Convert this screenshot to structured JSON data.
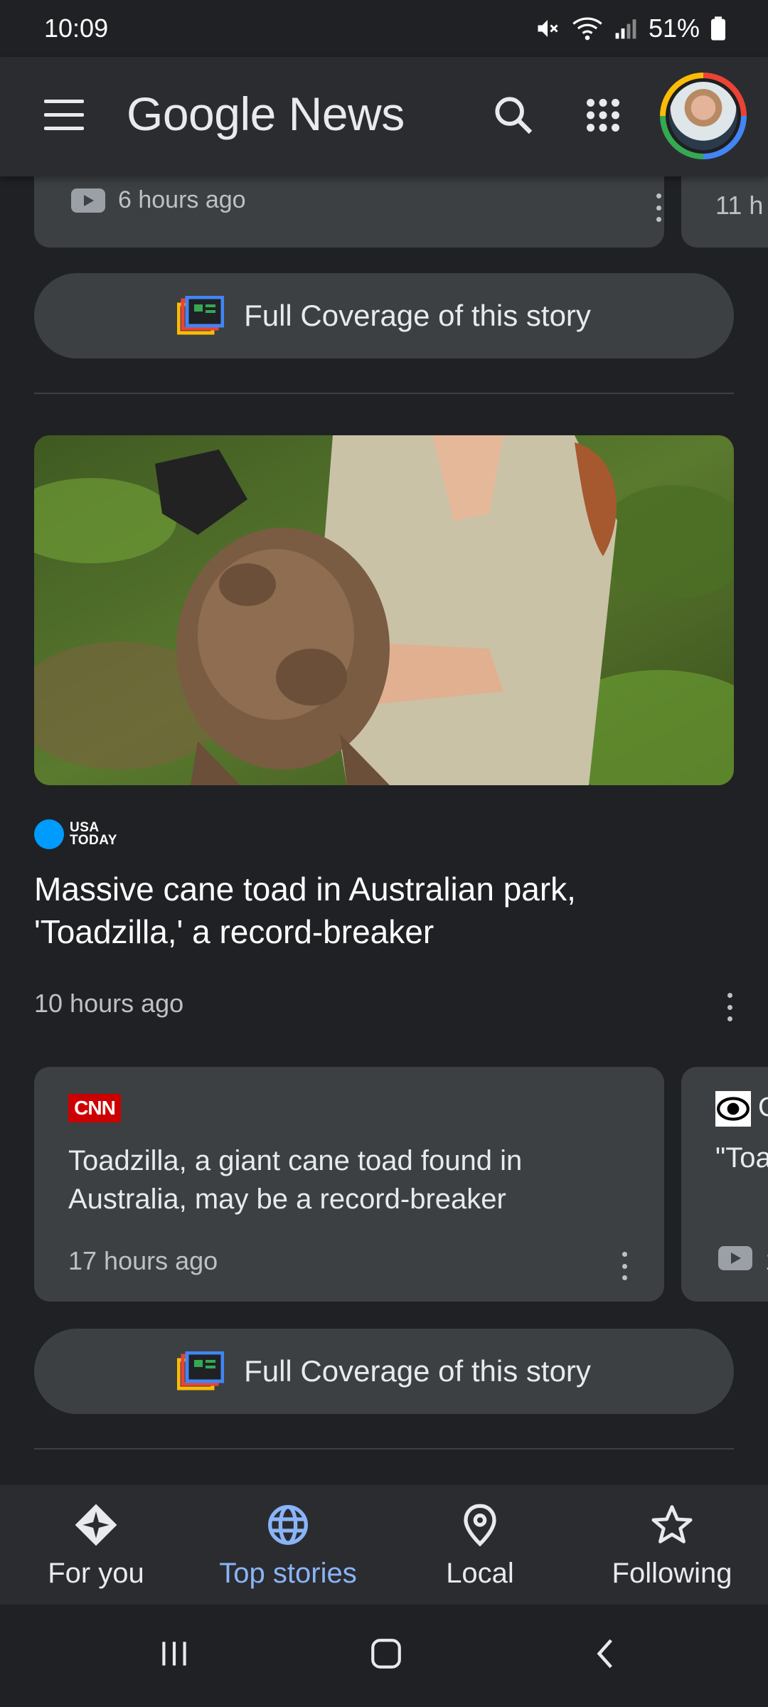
{
  "status": {
    "time": "10:09",
    "battery": "51%"
  },
  "app": {
    "title": "Google News"
  },
  "top_partial": {
    "time": "6 hours ago",
    "next_card_partial": "11 h"
  },
  "full_coverage_label": "Full Coverage of this story",
  "story": {
    "source": [
      "USA",
      "TODAY"
    ],
    "headline": "Massive cane toad in Australian park, 'Toadzilla,' a record-breaker",
    "time": "10 hours ago"
  },
  "related": {
    "source_logo": "CNN",
    "title": "Toadzilla, a giant cane toad found in Australia, may be a record-breaker",
    "time": "17 hours ago",
    "next_card_source_partial": "C",
    "next_card_title_partial": "\"Toa",
    "next_card_time_partial": "1"
  },
  "nav": {
    "items": [
      {
        "label": "For you",
        "icon": "for-you-icon"
      },
      {
        "label": "Top stories",
        "icon": "globe-icon"
      },
      {
        "label": "Local",
        "icon": "location-pin-icon"
      },
      {
        "label": "Following",
        "icon": "star-icon"
      }
    ],
    "active": "Top stories"
  },
  "colors": {
    "background": "#202124",
    "card": "#3c4043",
    "accent": "#8ab4f8"
  }
}
